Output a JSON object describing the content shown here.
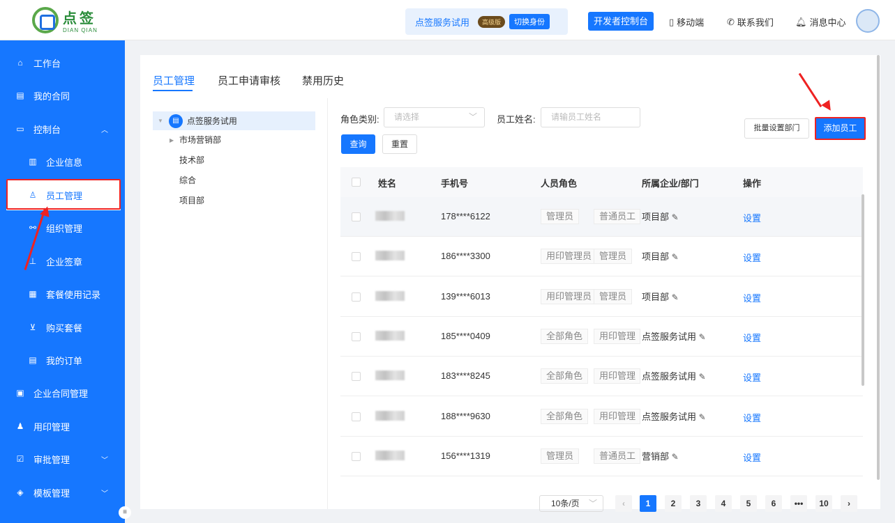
{
  "header": {
    "logo_cn": "点签",
    "logo_en": "DIAN QIAN",
    "trial_text": "点签服务试用",
    "trial_badge": "高级版",
    "switch_label": "切换身份",
    "dev_console": "开发者控制台",
    "mobile": "移动端",
    "contact": "联系我们",
    "messages": "消息中心"
  },
  "sidebar": {
    "workbench": "工作台",
    "my_contracts": "我的合同",
    "console": "控制台",
    "company_info": "企业信息",
    "staff_mgmt": "员工管理",
    "org_mgmt": "组织管理",
    "company_seal": "企业签章",
    "package_usage": "套餐使用记录",
    "buy_package": "购买套餐",
    "my_orders": "我的订单",
    "company_contracts": "企业合同管理",
    "seal_mgmt": "用印管理",
    "approval_mgmt": "审批管理",
    "template_mgmt": "模板管理"
  },
  "tabs": [
    "员工管理",
    "员工申请审核",
    "禁用历史"
  ],
  "tree": {
    "root": "点签服务试用",
    "nodes": [
      "市场营销部",
      "技术部",
      "综合",
      "项目部"
    ]
  },
  "filters": {
    "role_label": "角色类别:",
    "role_placeholder": "请选择",
    "name_label": "员工姓名:",
    "name_placeholder": "请输员工姓名",
    "query": "查询",
    "reset": "重置",
    "batch_dept": "批量设置部门",
    "add_staff": "添加员工"
  },
  "table": {
    "headers": [
      "姓名",
      "手机号",
      "人员角色",
      "所属企业/部门",
      "操作"
    ],
    "rows": [
      {
        "phone": "178****6122",
        "roles": [
          "管理员",
          "普通员工"
        ],
        "dept": "项目部",
        "action": "设置"
      },
      {
        "phone": "186****3300",
        "roles": [
          "用印管理员",
          "管理员"
        ],
        "dept": "项目部",
        "action": "设置"
      },
      {
        "phone": "139****6013",
        "roles": [
          "用印管理员",
          "管理员"
        ],
        "dept": "项目部",
        "action": "设置"
      },
      {
        "phone": "185****0409",
        "roles": [
          "全部角色",
          "用印管理"
        ],
        "dept": "点签服务试用",
        "action": "设置"
      },
      {
        "phone": "183****8245",
        "roles": [
          "全部角色",
          "用印管理"
        ],
        "dept": "点签服务试用",
        "action": "设置"
      },
      {
        "phone": "188****9630",
        "roles": [
          "全部角色",
          "用印管理"
        ],
        "dept": "点签服务试用",
        "action": "设置"
      },
      {
        "phone": "156****1319",
        "roles": [
          "管理员",
          "普通员工"
        ],
        "dept": "营销部",
        "action": "设置"
      }
    ]
  },
  "pagination": {
    "page_size": "10条/页",
    "pages": [
      "1",
      "2",
      "3",
      "4",
      "5",
      "6",
      "•••",
      "10"
    ],
    "current": "1"
  },
  "colors": {
    "primary": "#1677ff",
    "highlight": "#ee2222"
  }
}
